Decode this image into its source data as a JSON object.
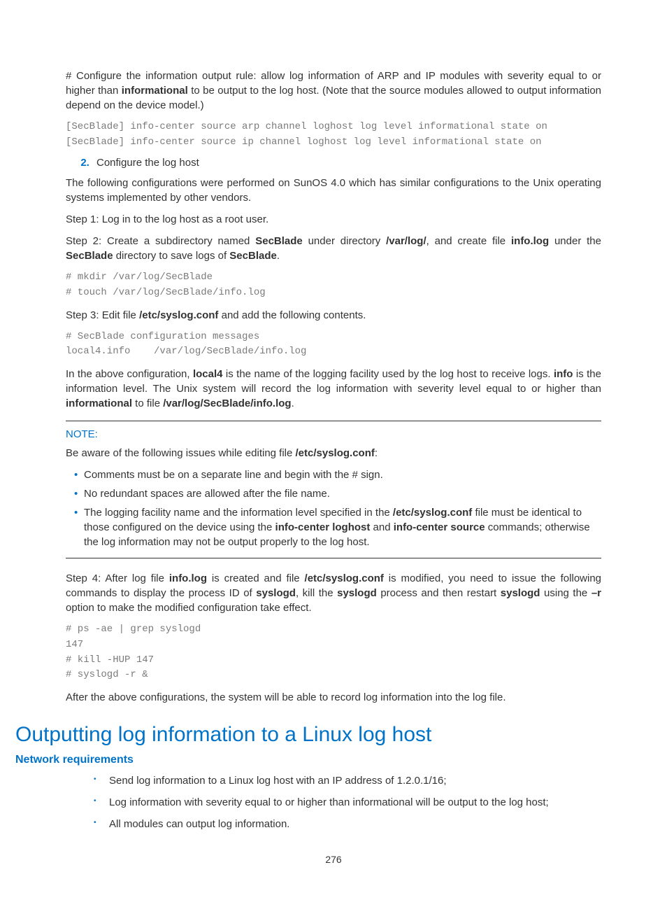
{
  "intro": {
    "config_rule_p1": "# Configure the information output rule: allow log information of ARP and IP modules with severity equal to or higher than ",
    "config_rule_b1": "informational",
    "config_rule_p2": " to be output to the log host. (Note that the source modules allowed to output information depend on the device model.)"
  },
  "code1": "[SecBlade] info-center source arp channel loghost log level informational state on\n[SecBlade] info-center source ip channel loghost log level informational state on",
  "step2_list": "Configure the log host",
  "after_step2": "The following configurations were performed on SunOS 4.0 which has similar configurations to the Unix operating systems implemented by other vendors.",
  "step1": "Step 1: Log in to the log host as a root user.",
  "step2_p1": "Step 2: Create a subdirectory named ",
  "step2_b1": "SecBlade",
  "step2_p2": " under directory ",
  "step2_b2": "/var/log/",
  "step2_p3": ", and create file ",
  "step2_b3": "info.log",
  "step2_p4": " under the ",
  "step2_b4": "SecBlade",
  "step2_p5": " directory to save logs of ",
  "step2_b5": "SecBlade",
  "step2_p6": ".",
  "code2": "# mkdir /var/log/SecBlade\n# touch /var/log/SecBlade/info.log",
  "step3_p1": "Step 3: Edit file ",
  "step3_b1": "/etc/syslog.conf",
  "step3_p2": " and add the following contents.",
  "code3": "# SecBlade configuration messages\nlocal4.info    /var/log/SecBlade/info.log",
  "explain_p1": "In the above configuration, ",
  "explain_b1": "local4",
  "explain_p2": " is the name of the logging facility used by the log host to receive logs. ",
  "explain_b2": "info",
  "explain_p3": " is the information level. The Unix system will record the log information with severity level equal to or higher than ",
  "explain_b3": "informational",
  "explain_p4": " to file ",
  "explain_b4": "/var/log/SecBlade/info.log",
  "explain_p5": ".",
  "note": {
    "label": "NOTE:",
    "intro_p1": "Be aware of the following issues while editing file ",
    "intro_b1": "/etc/syslog.conf",
    "intro_p2": ":",
    "bullets": [
      {
        "text": "Comments must be on a separate line and begin with the # sign."
      },
      {
        "text": "No redundant spaces are allowed after the file name."
      },
      {
        "p1": "The logging facility name and the information level specified in the ",
        "b1": "/etc/syslog.conf",
        "p2": " file must be identical to those configured on the device using the ",
        "b2": "info-center loghost",
        "p3": " and ",
        "b3": "info-center source",
        "p4": " commands; otherwise the log information may not be output properly to the log host."
      }
    ]
  },
  "step4_p1": "Step 4: After log file ",
  "step4_b1": "info.log",
  "step4_p2": " is created and file ",
  "step4_b2": "/etc/syslog.conf",
  "step4_p3": " is modified, you need to issue the following commands to display the process ID of ",
  "step4_b3": "syslogd",
  "step4_p4": ", kill the ",
  "step4_b4": "syslogd",
  "step4_p5": " process and then restart ",
  "step4_b5": "syslogd",
  "step4_p6": " using the ",
  "step4_b6": "–r",
  "step4_p7": " option to make the modified configuration take effect.",
  "code4": "# ps -ae | grep syslogd\n147\n# kill -HUP 147\n# syslogd -r &",
  "conclusion": "After the above configurations, the system will be able to record log information into the log file.",
  "section_heading": "Outputting log information to a Linux log host",
  "subsection_heading": "Network requirements",
  "reqs": [
    "Send log information to a Linux log host with an IP address of 1.2.0.1/16;",
    "Log information with severity equal to or higher than informational will be output to the log host;",
    "All modules can output log information."
  ],
  "page_number": "276"
}
